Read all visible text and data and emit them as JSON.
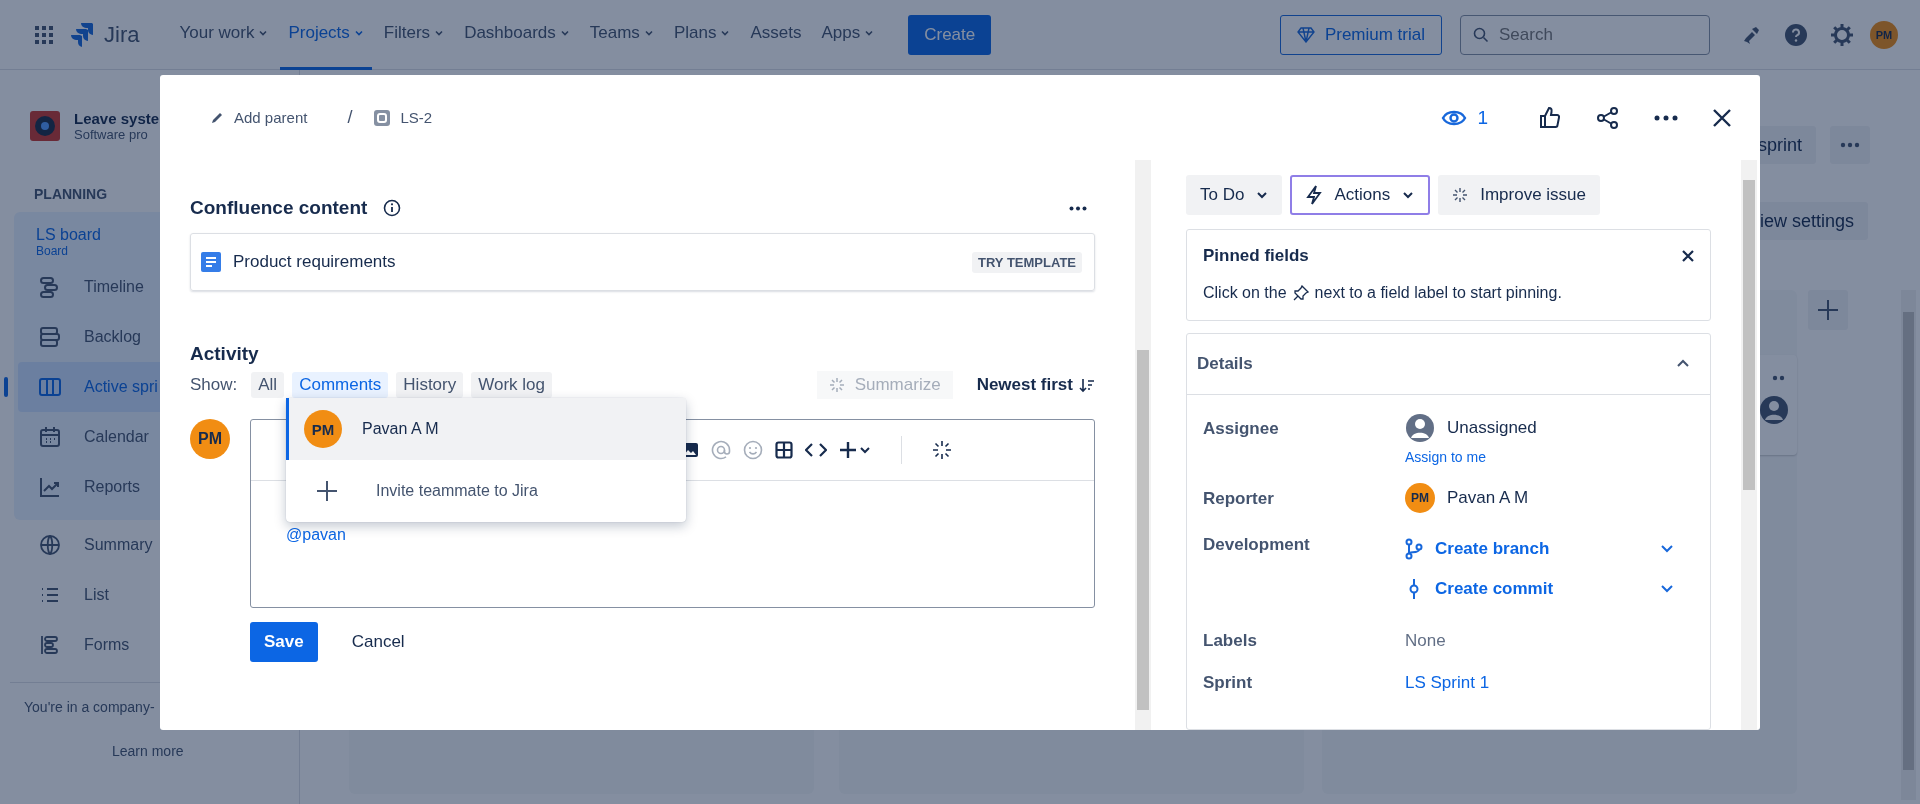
{
  "top_nav": {
    "product": "Jira",
    "items": [
      {
        "label": "Your work",
        "dropdown": true,
        "selected": false
      },
      {
        "label": "Projects",
        "dropdown": true,
        "selected": true
      },
      {
        "label": "Filters",
        "dropdown": true,
        "selected": false
      },
      {
        "label": "Dashboards",
        "dropdown": true,
        "selected": false
      },
      {
        "label": "Teams",
        "dropdown": true,
        "selected": false
      },
      {
        "label": "Plans",
        "dropdown": true,
        "selected": false
      },
      {
        "label": "Assets",
        "dropdown": false,
        "selected": false
      },
      {
        "label": "Apps",
        "dropdown": true,
        "selected": false
      }
    ],
    "create_button": "Create",
    "premium_button": "Premium trial",
    "search": {
      "placeholder": "Search"
    },
    "avatar": "PM"
  },
  "sidebar": {
    "project_name": "Leave syste",
    "project_type": "Software pro",
    "section": "PLANNING",
    "board": {
      "name": "LS board",
      "type": "Board"
    },
    "planning_items": [
      {
        "label": "Timeline",
        "kind": "timeline",
        "selected": false
      },
      {
        "label": "Backlog",
        "kind": "backlog",
        "selected": false
      },
      {
        "label": "Active spri",
        "kind": "board",
        "selected": true
      },
      {
        "label": "Calendar",
        "kind": "calendar",
        "selected": false
      },
      {
        "label": "Reports",
        "kind": "reports",
        "selected": false
      }
    ],
    "items": [
      {
        "label": "Summary",
        "kind": "globe",
        "selected": false
      },
      {
        "label": "List",
        "kind": "list",
        "selected": false
      },
      {
        "label": "Forms",
        "kind": "forms",
        "selected": false
      }
    ],
    "footer_text": "You're in a company-",
    "footer_link": "Learn more"
  },
  "board_header": {
    "buttons": [
      "sprint",
      "iew settings"
    ]
  },
  "issue": {
    "breadcrumb": {
      "parent": "Add parent",
      "separator": "/",
      "key": "LS-2"
    },
    "watchers": "1",
    "confluence": {
      "title": "Confluence content",
      "page": "Product requirements",
      "badge": "TRY TEMPLATE"
    },
    "activity": {
      "title": "Activity",
      "show_label": "Show:",
      "filters": [
        {
          "label": "All",
          "selected": false
        },
        {
          "label": "Comments",
          "selected": true
        },
        {
          "label": "History",
          "selected": false
        },
        {
          "label": "Work log",
          "selected": false
        }
      ],
      "summarize": "Summarize",
      "sort": "Newest first",
      "avatar": "PM",
      "comment": "@pavan",
      "save": "Save",
      "cancel": "Cancel",
      "mention_menu": [
        {
          "kind": "user",
          "label": "Pavan A M",
          "avatar": "PM",
          "selected": true
        },
        {
          "kind": "invite",
          "label": "Invite teammate to Jira",
          "selected": false
        }
      ]
    },
    "status": "To Do",
    "actions": "Actions",
    "improve": "Improve issue",
    "pinned": {
      "title": "Pinned fields",
      "text_before": "Click on the",
      "text_after": "next to a field label to start pinning."
    },
    "details": {
      "title": "Details",
      "expanded": true,
      "fields": [
        {
          "label": "Assignee",
          "kind": "assignee",
          "value": "Unassigned",
          "link": "Assign to me"
        },
        {
          "label": "Reporter",
          "kind": "user",
          "value": "Pavan A M",
          "avatar": "PM"
        },
        {
          "label": "Development",
          "kind": "development",
          "items": [
            "Create branch",
            "Create commit"
          ]
        },
        {
          "label": "Labels",
          "kind": "none",
          "value": "None"
        },
        {
          "label": "Sprint",
          "kind": "link",
          "value": "LS Sprint 1"
        }
      ]
    }
  }
}
